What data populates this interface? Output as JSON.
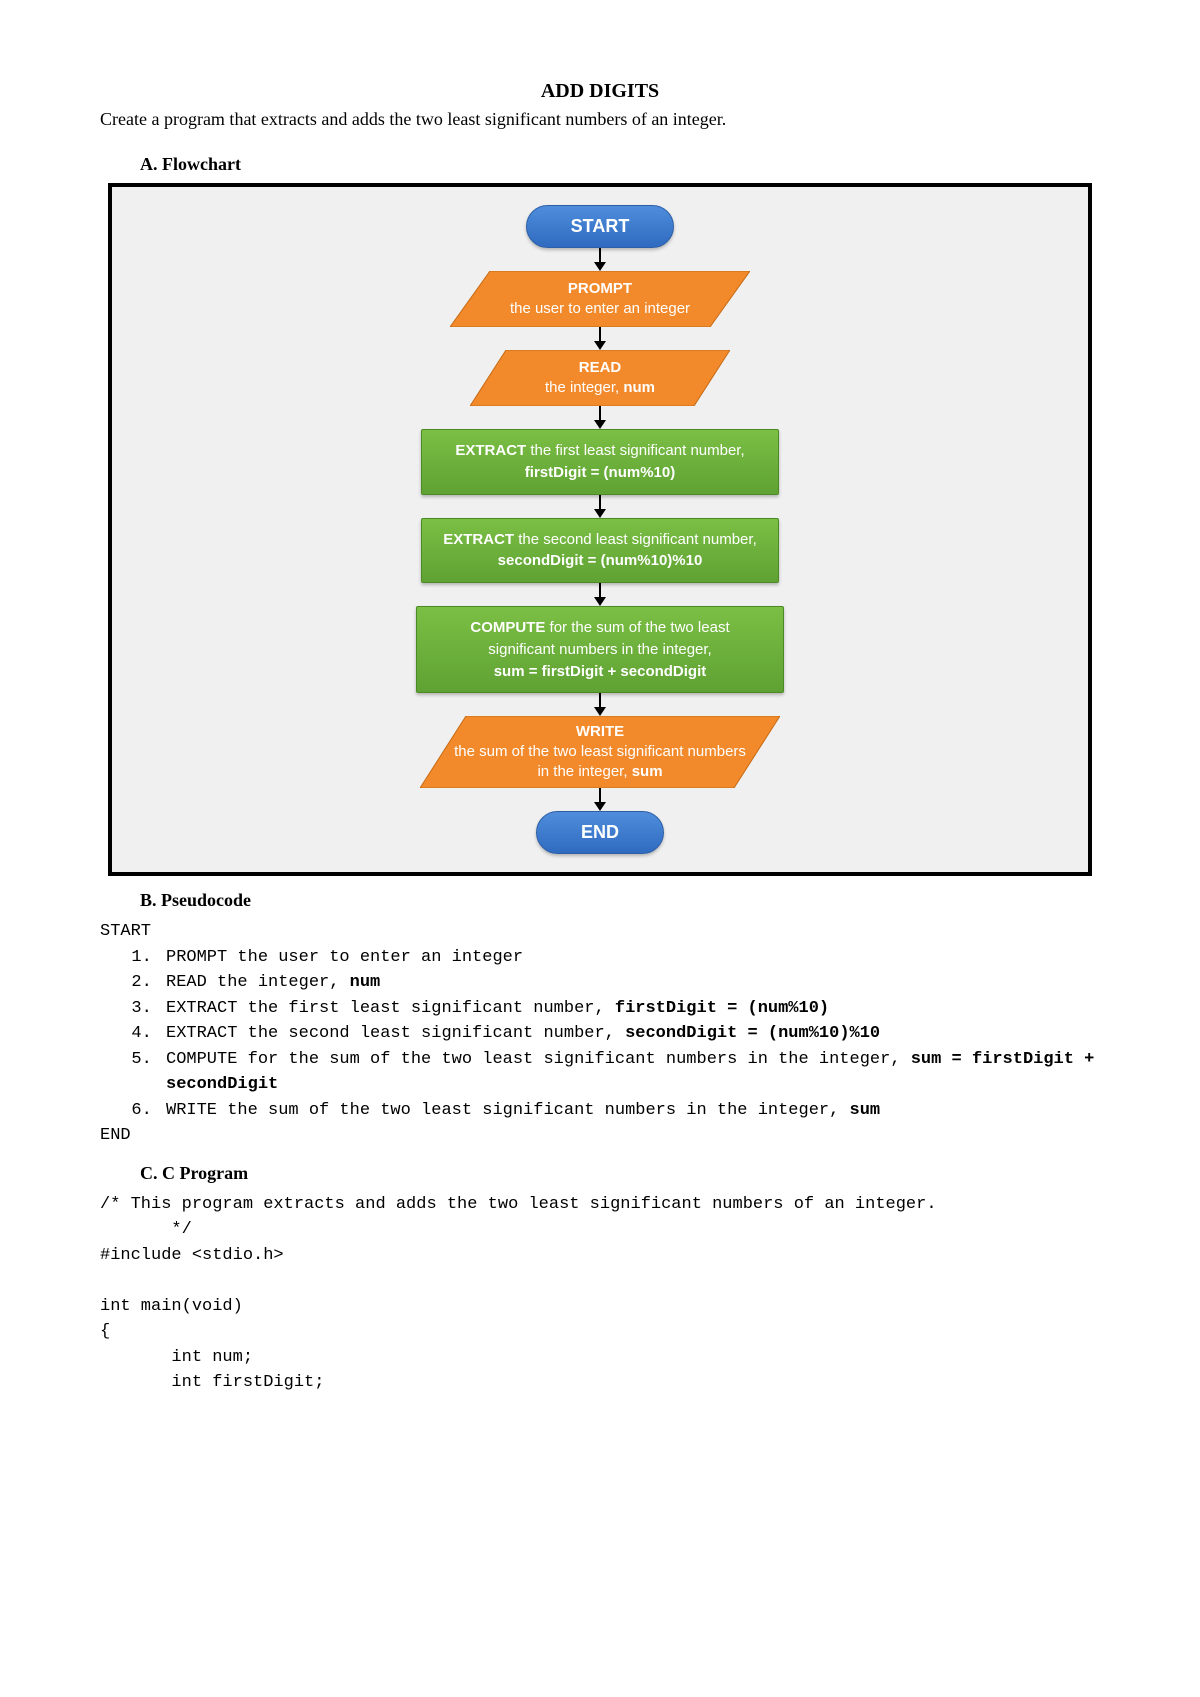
{
  "title": "ADD DIGITS",
  "description": "Create a program that extracts and adds the two least significant numbers of an integer.",
  "sections": {
    "a": "A.  Flowchart",
    "b": "B.  Pseudocode",
    "c": "C.  C Program"
  },
  "flowchart": {
    "start": "START",
    "prompt_head": "PROMPT",
    "prompt_body": "the user to enter an integer",
    "read_head": "READ",
    "read_body_a": "the integer, ",
    "read_body_b": "num",
    "extract1_a": "EXTRACT",
    "extract1_b": " the first least significant number, ",
    "extract1_c": "firstDigit = (num%10)",
    "extract2_a": "EXTRACT",
    "extract2_b": " the second least significant number, ",
    "extract2_c": "secondDigit = (num%10)%10",
    "compute_a": "COMPUTE",
    "compute_b": " for the sum of the two least significant numbers in the integer,",
    "compute_c": "sum = firstDigit + secondDigit",
    "write_head": "WRITE",
    "write_body_a": "the sum of the two least significant numbers in the integer, ",
    "write_body_b": "sum",
    "end": "END"
  },
  "pseudocode": {
    "start": "START",
    "l1": "PROMPT the user to enter an integer",
    "l2a": "READ the integer, ",
    "l2b": "num",
    "l3a": "EXTRACT the first least significant number, ",
    "l3b": "firstDigit = (num%10)",
    "l4a": "EXTRACT the second least significant number, ",
    "l4b": "secondDigit = (num%10)%10",
    "l5a": "COMPUTE for the sum of the two least significant numbers in the integer, ",
    "l5b": "sum = firstDigit + secondDigit",
    "l6a": "WRITE the sum of the two least significant numbers in the integer, ",
    "l6b": "sum",
    "end": "END"
  },
  "cprogram": "/* This program extracts and adds the two least significant numbers of an integer.\n       */\n#include <stdio.h>\n\nint main(void)\n{\n       int num;\n       int firstDigit;"
}
